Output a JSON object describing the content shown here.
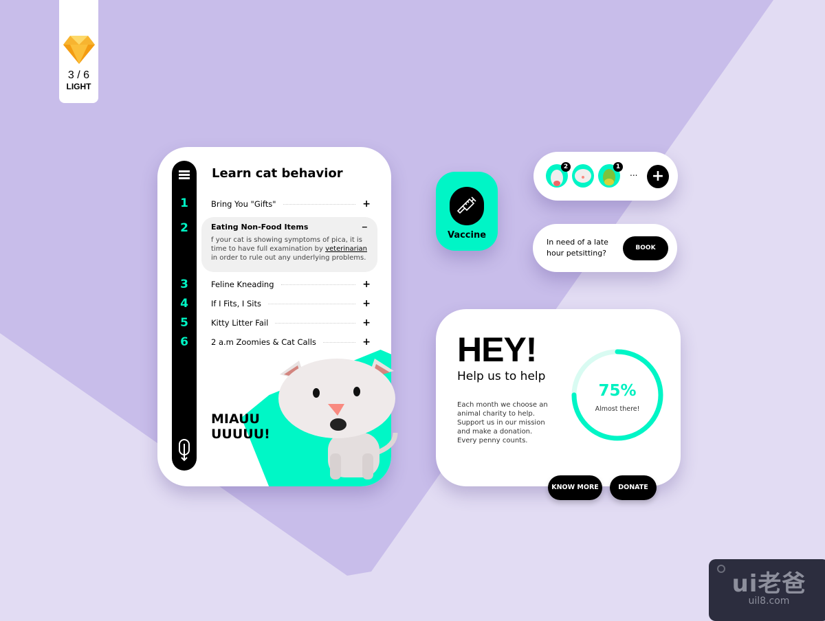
{
  "tag": {
    "page": "3 / 6",
    "mode": "LIGHT",
    "icon": "sketch-diamond-icon"
  },
  "learn": {
    "title": "Learn cat behavior",
    "items": [
      {
        "num": "1",
        "label": "Bring You \"Gifts\"",
        "icon": "+"
      },
      {
        "num": "2",
        "label": "Eating Non-Food Items",
        "icon": "−",
        "body_pre": "f your cat is showing symptoms of pica, it is time to have full examination by ",
        "body_link": "veterinarian",
        "body_post": " in order to rule out any underlying problems."
      },
      {
        "num": "3",
        "label": "Feline Kneading",
        "icon": "+"
      },
      {
        "num": "4",
        "label": "If I Fits, I Sits",
        "icon": "+"
      },
      {
        "num": "5",
        "label": "Kitty Litter Fail",
        "icon": "+"
      },
      {
        "num": "6",
        "label": "2 a.m Zoomies & Cat Calls",
        "icon": "+"
      }
    ],
    "miau_line1": "MIAUU",
    "miau_line2": "UUUUU!"
  },
  "vaccine": {
    "label": "Vaccine",
    "icon": "syringe-icon"
  },
  "pets": {
    "badges": [
      "2",
      "",
      "1"
    ],
    "more": "...",
    "add": "+"
  },
  "book": {
    "question": "In need of a late hour petsitting?",
    "button": "BOOK"
  },
  "help": {
    "title": "HEY!",
    "subtitle": "Help us to help",
    "description": "Each month we choose an animal charity to help. Support us in our mission and make a donation. Every penny counts.",
    "progress_percent": 75,
    "progress_label": "75%",
    "progress_caption": "Almost there!",
    "know_more": "KNOW MORE",
    "donate": "DONATE"
  },
  "watermark": {
    "logo": "ui老爸",
    "url": "uil8.com"
  },
  "colors": {
    "accent": "#00f5c6",
    "bg": "#e2dcf3",
    "purple": "#c8bdea"
  }
}
